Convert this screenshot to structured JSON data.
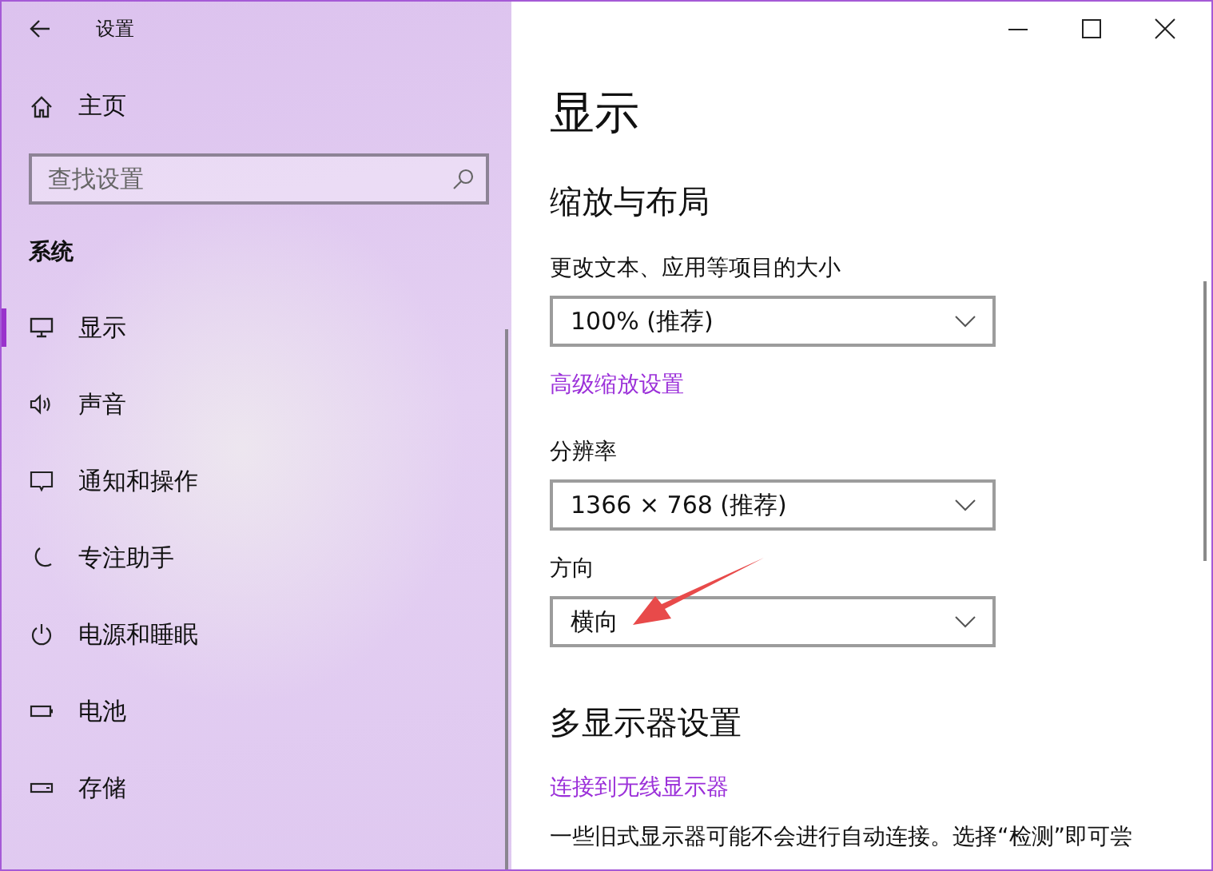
{
  "window": {
    "title": "设置"
  },
  "sidebar": {
    "home": "主页",
    "search": {
      "placeholder": "查找设置"
    },
    "section": "系统",
    "items": [
      {
        "label": "显示",
        "kind": "monitor",
        "selected": true
      },
      {
        "label": "声音",
        "kind": "speaker",
        "selected": false
      },
      {
        "label": "通知和操作",
        "kind": "message",
        "selected": false
      },
      {
        "label": "专注助手",
        "kind": "moon",
        "selected": false
      },
      {
        "label": "电源和睡眠",
        "kind": "power",
        "selected": false
      },
      {
        "label": "电池",
        "kind": "battery",
        "selected": false
      },
      {
        "label": "存储",
        "kind": "storage",
        "selected": false
      }
    ]
  },
  "content": {
    "title": "显示",
    "section": "缩放与布局",
    "fields": [
      {
        "label": "更改文本、应用等项目的大小",
        "value": "100% (推荐)"
      },
      {
        "label": "分辨率",
        "value": "1366 × 768 (推荐)"
      },
      {
        "label": "方向",
        "value": "横向"
      }
    ],
    "scale_link": "高级缩放设置",
    "multi_section": "多显示器设置",
    "wireless_link": "连接到无线显示器",
    "note": "一些旧式显示器可能不会进行自动连接。选择“检测”即可尝"
  }
}
